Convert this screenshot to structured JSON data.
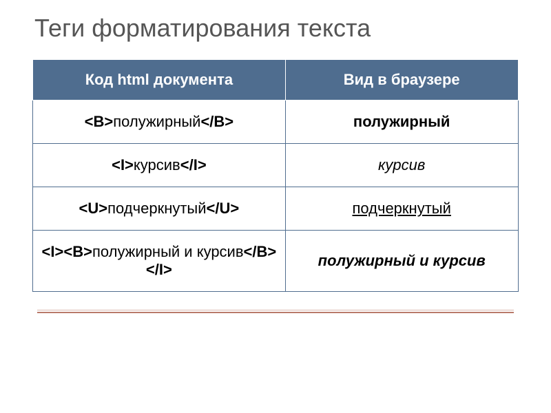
{
  "title": "Теги форматирования текста",
  "headers": {
    "code": "Код html документа",
    "render": "Вид в браузере"
  },
  "rows": [
    {
      "tag_open": "<B>",
      "tag_text": "полужирный",
      "tag_close": "</B>",
      "render": "полужирный",
      "render_class": "rendered-bold"
    },
    {
      "tag_open": "<I>",
      "tag_text": "курсив",
      "tag_close": "</I>",
      "render": "курсив",
      "render_class": "rendered-italic"
    },
    {
      "tag_open": "<U>",
      "tag_text": "подчеркнутый",
      "tag_close": "</U>",
      "render": "подчеркнутый",
      "render_class": "rendered-underline"
    },
    {
      "tag_open": "<I><B>",
      "tag_text": "полужирный и курсив",
      "tag_close": "</B></I>",
      "render": "полужирный и курсив",
      "render_class": "rendered-bolditalic"
    }
  ]
}
